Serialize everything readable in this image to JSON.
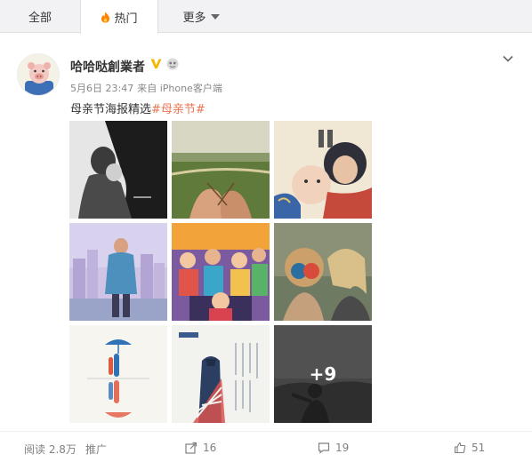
{
  "tabs": {
    "all": "全部",
    "hot": "热门",
    "more": "更多"
  },
  "post": {
    "user_name": "哈哈哒創業者",
    "date": "5月6日 23:47",
    "source": "来自 iPhone客户端",
    "text": "母亲节海报精选",
    "hashtag": "#母亲节#",
    "more_images": "+9"
  },
  "footer": {
    "views": "阅读 2.8万",
    "promote": "推广",
    "reposts": "16",
    "comments": "19",
    "likes": "51"
  },
  "colors": {
    "accent": "#eb7350",
    "badge": "#f7b500",
    "tab_bg": "#f2f2f5"
  }
}
